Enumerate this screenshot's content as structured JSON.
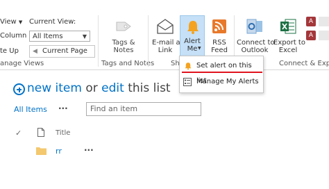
{
  "ribbon": {
    "view_label": "View",
    "current_view_label": "Current View:",
    "column_label": "Column",
    "current_view_value": "All Items",
    "state_label": "te Up",
    "current_page_label": "Current Page",
    "manage_views_label": "anage Views",
    "tags_notes_label": "Tags &\nNotes",
    "tags_and_notes_group": "Tags and Notes",
    "email_link_label": "E-mail a\nLink",
    "alert_me_label": "Alert\nMe",
    "rss_feed_label": "RSS\nFeed",
    "share_group_partial": "Sh",
    "connect_outlook_label": "Connect to\nOutlook",
    "export_excel_label": "Export to\nExcel",
    "connect_export_group": "Connect & Expor"
  },
  "alert_menu": {
    "items": [
      "Set alert on this list",
      "Manage My Alerts"
    ]
  },
  "main": {
    "new_item": "new item",
    "or": "or",
    "edit": "edit",
    "this_list": "this list",
    "all_items": "All Items",
    "more": "···",
    "search_placeholder": "Find an item",
    "column_title": "Title",
    "rows": [
      {
        "title": "rr",
        "more": "···"
      }
    ]
  },
  "colors": {
    "accent_blue": "#0072c6",
    "highlight_blue": "#c5e0f7",
    "annotation_red": "#e0141e",
    "bell_orange": "#f4a321",
    "rss_orange": "#e8792b",
    "excel_green": "#1e7145",
    "folder_yellow": "#f3c86e"
  }
}
